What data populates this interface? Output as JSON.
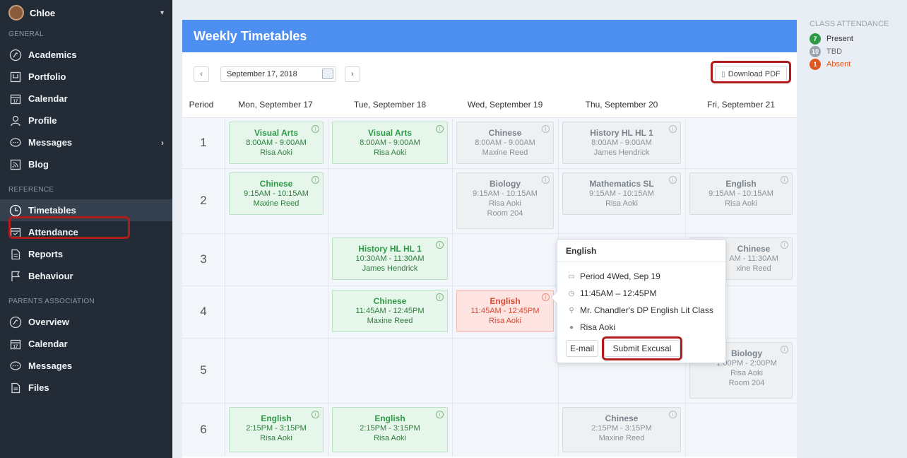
{
  "sidebar": {
    "user": "Chloe",
    "sections": {
      "general": "GENERAL",
      "reference": "REFERENCE",
      "parents": "PARENTS ASSOCIATION"
    },
    "general_items": [
      {
        "label": "Academics",
        "icon": "academics-icon"
      },
      {
        "label": "Portfolio",
        "icon": "portfolio-icon"
      },
      {
        "label": "Calendar",
        "icon": "calendar-icon"
      },
      {
        "label": "Profile",
        "icon": "profile-icon"
      },
      {
        "label": "Messages",
        "icon": "messages-icon"
      },
      {
        "label": "Blog",
        "icon": "blog-icon"
      }
    ],
    "reference_items": [
      {
        "label": "Timetables",
        "icon": "clock-icon"
      },
      {
        "label": "Attendance",
        "icon": "attendance-icon"
      },
      {
        "label": "Reports",
        "icon": "reports-icon"
      },
      {
        "label": "Behaviour",
        "icon": "flag-icon"
      }
    ],
    "parents_items": [
      {
        "label": "Overview",
        "icon": "overview-icon"
      },
      {
        "label": "Calendar",
        "icon": "calendar-icon"
      },
      {
        "label": "Messages",
        "icon": "messages-icon"
      },
      {
        "label": "Files",
        "icon": "files-icon"
      }
    ]
  },
  "main": {
    "title": "Weekly Timetables",
    "date": "September 17, 2018",
    "prev": "‹",
    "next": "›",
    "download_pdf": "Download PDF",
    "headers": [
      "Period",
      "Mon, September 17",
      "Tue, September 18",
      "Wed, September 19",
      "Thu, September 20",
      "Fri, September 21"
    ],
    "periods": [
      "1",
      "2",
      "3",
      "4",
      "5",
      "6"
    ],
    "classes": {
      "mon1": {
        "title": "Visual Arts",
        "time": "8:00AM - 9:00AM",
        "teacher": "Risa Aoki"
      },
      "tue1": {
        "title": "Visual Arts",
        "time": "8:00AM - 9:00AM",
        "teacher": "Risa Aoki"
      },
      "wed1": {
        "title": "Chinese",
        "time": "8:00AM - 9:00AM",
        "teacher": "Maxine Reed"
      },
      "thu1": {
        "title": "History HL HL 1",
        "time": "8:00AM - 9:00AM",
        "teacher": "James Hendrick"
      },
      "mon2": {
        "title": "Chinese",
        "time": "9:15AM - 10:15AM",
        "teacher": "Maxine Reed"
      },
      "wed2": {
        "title": "Biology",
        "time": "9:15AM - 10:15AM",
        "teacher": "Risa Aoki",
        "room": "Room 204"
      },
      "thu2": {
        "title": "Mathematics SL",
        "time": "9:15AM - 10:15AM",
        "teacher": "Risa Aoki"
      },
      "fri2": {
        "title": "English",
        "time": "9:15AM - 10:15AM",
        "teacher": "Risa Aoki"
      },
      "tue3": {
        "title": "History HL HL 1",
        "time": "10:30AM - 11:30AM",
        "teacher": "James Hendrick"
      },
      "fri3": {
        "title": "Chinese",
        "time": "AM - 11:30AM",
        "teacher": "xine Reed"
      },
      "tue4": {
        "title": "Chinese",
        "time": "11:45AM - 12:45PM",
        "teacher": "Maxine Reed"
      },
      "wed4": {
        "title": "English",
        "time": "11:45AM - 12:45PM",
        "teacher": "Risa Aoki"
      },
      "fri5": {
        "title": "Biology",
        "time": "1:00PM - 2:00PM",
        "teacher": "Risa Aoki",
        "room": "Room 204"
      },
      "mon6": {
        "title": "English",
        "time": "2:15PM - 3:15PM",
        "teacher": "Risa Aoki"
      },
      "tue6": {
        "title": "English",
        "time": "2:15PM - 3:15PM",
        "teacher": "Risa Aoki"
      },
      "thu6": {
        "title": "Chinese",
        "time": "2:15PM - 3:15PM",
        "teacher": "Maxine Reed"
      }
    }
  },
  "popover": {
    "title": "English",
    "period": "Period 4Wed, Sep 19",
    "time": "11:45AM – 12:45PM",
    "location": "Mr. Chandler's DP English Lit Class",
    "teacher": "Risa Aoki",
    "email": "E-mail",
    "submit": "Submit Excusal"
  },
  "attendance": {
    "title": "CLASS ATTENDANCE",
    "items": [
      {
        "count": "7",
        "label": "Present",
        "color": "#2e9a47"
      },
      {
        "count": "10",
        "label": "TBD",
        "color": "#9aa4ae"
      },
      {
        "count": "1",
        "label": "Absent",
        "color": "#e0561f"
      }
    ]
  },
  "colors": {
    "banner": "#4d8ff0",
    "sidebar": "#232b36",
    "highlight": "#b01c1c"
  }
}
